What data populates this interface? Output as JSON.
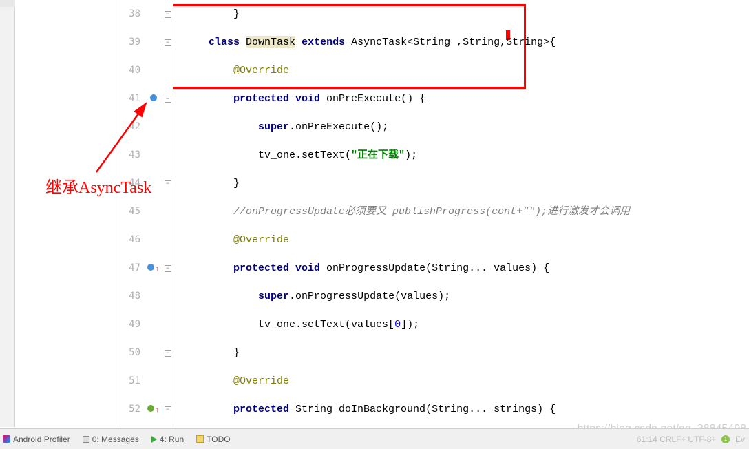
{
  "lines": [
    {
      "n": 38,
      "code_html": "         }"
    },
    {
      "n": 39,
      "code_html": "     <span class='kw'>class</span> <span class='hl'>DownTask</span> <span class='kw'>extends</span> AsyncTask&lt;String ,String,String&gt;{"
    },
    {
      "n": 40,
      "code_html": "         <span class='ann'>@Override</span>"
    },
    {
      "n": 41,
      "code_html": "         <span class='kw'>protected void</span> onPreExecute() {",
      "icon": "blue"
    },
    {
      "n": 42,
      "code_html": "             <span class='kw'>super</span>.onPreExecute();"
    },
    {
      "n": 43,
      "code_html": "             tv_one.setText(<span class='str'>\"正在下载\"</span>);"
    },
    {
      "n": 44,
      "code_html": "         }"
    },
    {
      "n": 45,
      "code_html": "         <span class='com'>//onProgressUpdate必须要又 publishProgress(cont+\"\");进行激发才会调用</span>"
    },
    {
      "n": 46,
      "code_html": "         <span class='ann'>@Override</span>"
    },
    {
      "n": 47,
      "code_html": "         <span class='kw'>protected void</span> onProgressUpdate(String... values) {",
      "icon": "blue-up"
    },
    {
      "n": 48,
      "code_html": "             <span class='kw'>super</span>.onProgressUpdate(values);"
    },
    {
      "n": 49,
      "code_html": "             tv_one.setText(values[<span class='num'>0</span>]);"
    },
    {
      "n": 50,
      "code_html": "         }"
    },
    {
      "n": 51,
      "code_html": "         <span class='ann'>@Override</span>"
    },
    {
      "n": 52,
      "code_html": "         <span class='kw'>protected</span> String doInBackground(String... strings) {",
      "icon": "green-up"
    }
  ],
  "annotation": {
    "text": "继承AsyncTask"
  },
  "bottom": {
    "profiler": "Android Profiler",
    "messages": "0: Messages",
    "run": "4: Run",
    "todo": "TODO",
    "status_right": "61:14  CRLF÷  UTF-8÷",
    "ev_label": "Ev"
  },
  "watermark": "https://blog.csdn.net/qq_38845498"
}
